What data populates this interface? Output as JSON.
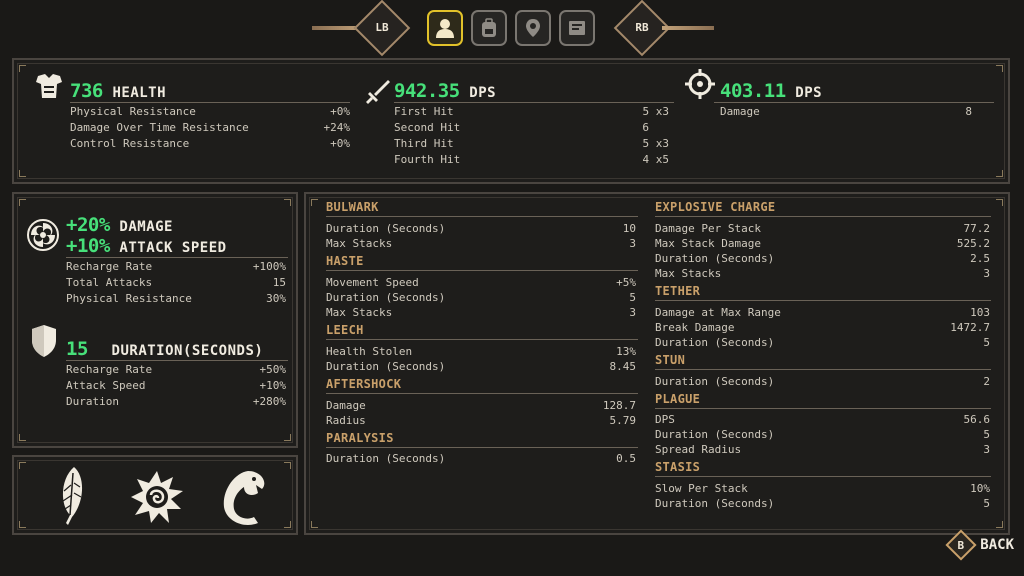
{
  "nav": {
    "left_bumper": "LB",
    "right_bumper": "RB",
    "tabs": [
      "profile",
      "backpack",
      "map-pin",
      "journal"
    ],
    "active_tab": "profile"
  },
  "stats": {
    "health": {
      "value": "736",
      "label": "HEALTH",
      "rows": [
        {
          "name": "Physical Resistance",
          "value": "+0%"
        },
        {
          "name": "Damage Over Time Resistance",
          "value": "+24%"
        },
        {
          "name": "Control Resistance",
          "value": "+0%"
        }
      ]
    },
    "melee": {
      "value": "942.35",
      "label": "DPS",
      "rows": [
        {
          "name": "First Hit",
          "value": "5",
          "mult": "x3"
        },
        {
          "name": "Second Hit",
          "value": "6",
          "mult": ""
        },
        {
          "name": "Third Hit",
          "value": "5",
          "mult": "x3"
        },
        {
          "name": "Fourth Hit",
          "value": "4",
          "mult": "x5"
        }
      ]
    },
    "ranged": {
      "value": "403.11",
      "label": "DPS",
      "rows": [
        {
          "name": "Damage",
          "value": "8"
        }
      ]
    }
  },
  "buffs": {
    "primary": {
      "line1_value": "+20%",
      "line1_label": "DAMAGE",
      "line2_value": "+10%",
      "line2_label": "ATTACK SPEED",
      "rows": [
        {
          "name": "Recharge Rate",
          "value": "+100%"
        },
        {
          "name": "Total Attacks",
          "value": "15"
        },
        {
          "name": "Physical Resistance",
          "value": "30%"
        }
      ]
    },
    "shield": {
      "value": "15",
      "label": "DURATION(SECONDS)",
      "rows": [
        {
          "name": "Recharge Rate",
          "value": "+50%"
        },
        {
          "name": "Attack Speed",
          "value": "+10%"
        },
        {
          "name": "Duration",
          "value": "+280%"
        }
      ]
    }
  },
  "effects_left": [
    {
      "title": "BULWARK",
      "rows": [
        {
          "name": "Duration (Seconds)",
          "value": "10"
        },
        {
          "name": "Max Stacks",
          "value": "3"
        }
      ]
    },
    {
      "title": "HASTE",
      "rows": [
        {
          "name": "Movement Speed",
          "value": "+5%"
        },
        {
          "name": "Duration (Seconds)",
          "value": "5"
        },
        {
          "name": "Max Stacks",
          "value": "3"
        }
      ]
    },
    {
      "title": "LEECH",
      "rows": [
        {
          "name": "Health Stolen",
          "value": "13%"
        },
        {
          "name": "Duration (Seconds)",
          "value": "8.45"
        }
      ]
    },
    {
      "title": "AFTERSHOCK",
      "rows": [
        {
          "name": "Damage",
          "value": "128.7"
        },
        {
          "name": "Radius",
          "value": "5.79"
        }
      ]
    },
    {
      "title": "PARALYSIS",
      "rows": [
        {
          "name": "Duration (Seconds)",
          "value": "0.5"
        }
      ]
    }
  ],
  "effects_right": [
    {
      "title": "EXPLOSIVE CHARGE",
      "rows": [
        {
          "name": "Damage Per Stack",
          "value": "77.2"
        },
        {
          "name": "Max Stack Damage",
          "value": "525.2"
        },
        {
          "name": "Duration (Seconds)",
          "value": "2.5"
        },
        {
          "name": "Max Stacks",
          "value": "3"
        }
      ]
    },
    {
      "title": "TETHER",
      "rows": [
        {
          "name": "Damage at Max Range",
          "value": "103"
        },
        {
          "name": "Break Damage",
          "value": "1472.7"
        },
        {
          "name": "Duration (Seconds)",
          "value": "5"
        }
      ]
    },
    {
      "title": "STUN",
      "rows": [
        {
          "name": "Duration (Seconds)",
          "value": "2"
        }
      ]
    },
    {
      "title": "PLAGUE",
      "rows": [
        {
          "name": "DPS",
          "value": "56.6"
        },
        {
          "name": "Duration (Seconds)",
          "value": "5"
        },
        {
          "name": "Spread Radius",
          "value": "3"
        }
      ]
    },
    {
      "title": "STASIS",
      "rows": [
        {
          "name": "Slow Per Stack",
          "value": "10%"
        },
        {
          "name": "Duration (Seconds)",
          "value": "5"
        }
      ]
    }
  ],
  "trinkets": [
    "feather-icon",
    "sun-spiral-icon",
    "serpent-icon"
  ],
  "back": {
    "key": "B",
    "label": "BACK"
  },
  "colors": {
    "accent_green": "#47e07a",
    "section_gold": "#c9a06a",
    "active_tab": "#e2c22a"
  }
}
